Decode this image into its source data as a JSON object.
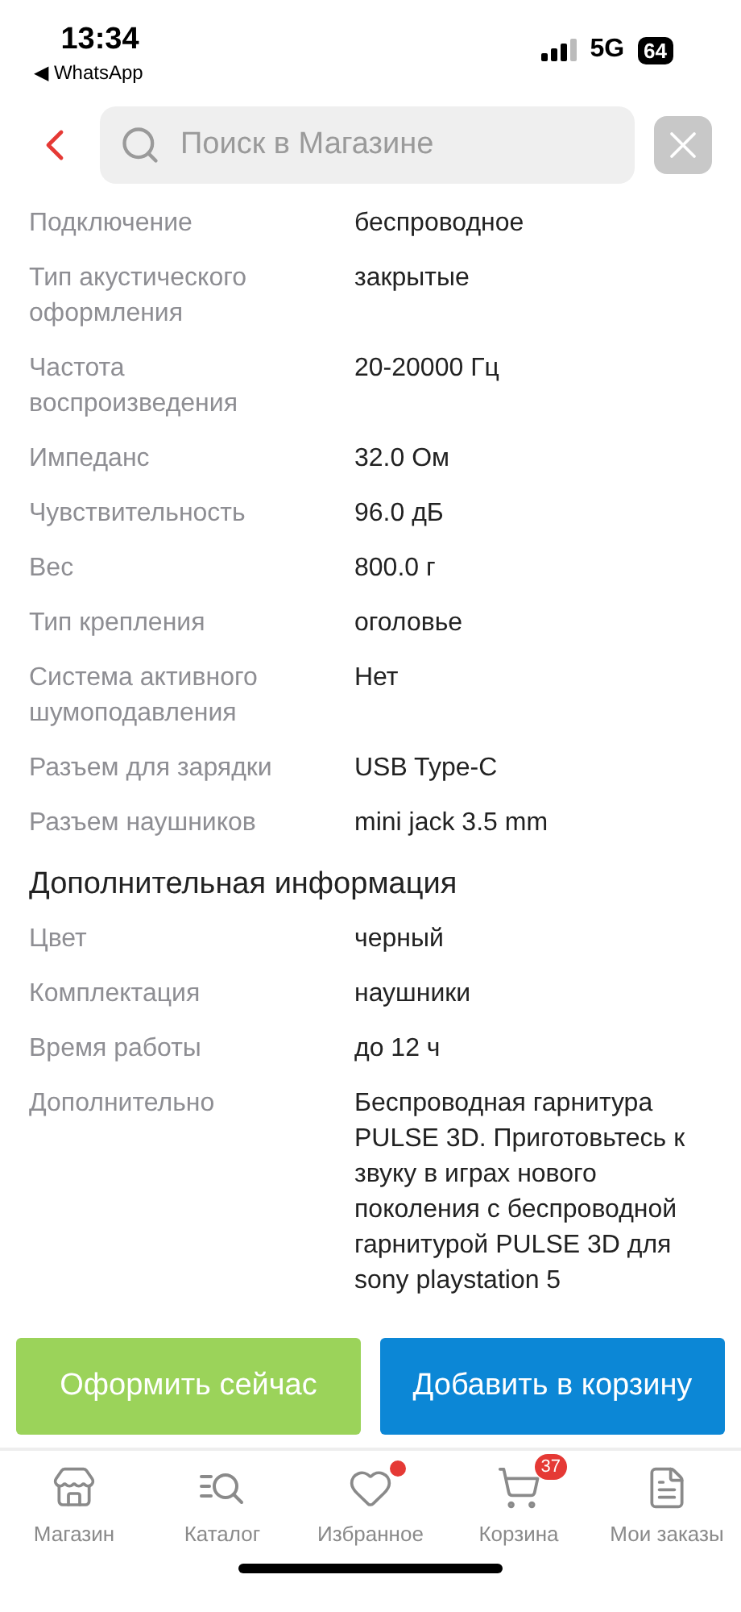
{
  "status_bar": {
    "time": "13:34",
    "back_app": "◀ WhatsApp",
    "network": "5G",
    "battery": "64"
  },
  "header": {
    "search_placeholder": "Поиск в Магазине"
  },
  "specs": [
    {
      "label": "Подключение",
      "value": "беспроводное"
    },
    {
      "label": "Тип акустического оформления",
      "value": "закрытые"
    },
    {
      "label": "Частота воспроизведения",
      "value": "20-20000 Гц"
    },
    {
      "label": "Импеданс",
      "value": "32.0 Ом"
    },
    {
      "label": "Чувствительность",
      "value": "96.0 дБ"
    },
    {
      "label": "Вес",
      "value": "800.0 г"
    },
    {
      "label": "Тип крепления",
      "value": "оголовье"
    },
    {
      "label": "Система активного шумоподавления",
      "value": "Нет"
    },
    {
      "label": "Разъем для зарядки",
      "value": "USB Type-C"
    },
    {
      "label": "Разъем наушников",
      "value": "mini jack 3.5 mm"
    }
  ],
  "extra_section": {
    "title": "Дополнительная информация",
    "specs": [
      {
        "label": "Цвет",
        "value": "черный"
      },
      {
        "label": "Комплектация",
        "value": "наушники"
      },
      {
        "label": "Время работы",
        "value": "до 12 ч"
      },
      {
        "label": "Дополнительно",
        "value": "Беспроводная гарнитура PULSE 3D. Приготовьтесь к звуку в играх нового поколения с беспроводной гарнитурой PULSE 3D для sony playstation 5"
      }
    ]
  },
  "buttons": [
    {
      "label": "Оформить сейчас",
      "kind": "buy"
    },
    {
      "label": "Добавить в корзину",
      "kind": "cart"
    }
  ],
  "nav": [
    {
      "label": "Магазин",
      "dot": false
    },
    {
      "label": "Каталог",
      "dot": false
    },
    {
      "label": "Избранное",
      "dot": true
    },
    {
      "label": "Корзина",
      "dot": false,
      "badge": "37"
    },
    {
      "label": "Мои заказы",
      "dot": false
    }
  ]
}
